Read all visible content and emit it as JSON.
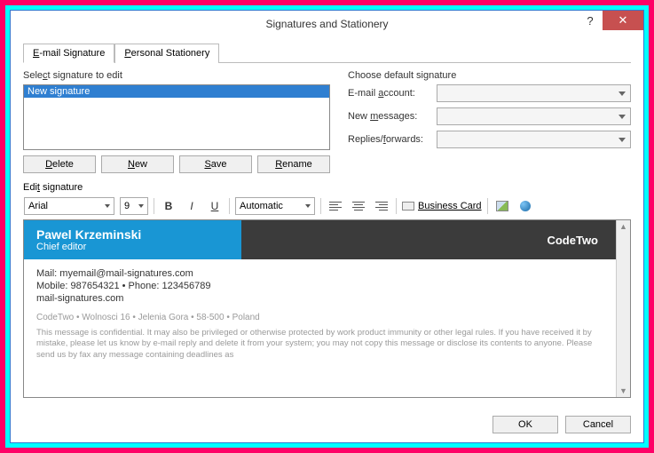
{
  "title": "Signatures and Stationery",
  "tabs": {
    "email": "E-mail Signature",
    "personal": "Personal Stationery"
  },
  "left": {
    "label": "Select signature to edit",
    "item": "New signature",
    "buttons": {
      "delete": "Delete",
      "new": "New",
      "save": "Save",
      "rename": "Rename"
    }
  },
  "right": {
    "label": "Choose default signature",
    "account": "E-mail account:",
    "newmsg": "New messages:",
    "replies": "Replies/forwards:"
  },
  "edit": {
    "label": "Edit signature",
    "font": "Arial",
    "size": "9",
    "auto": "Automatic",
    "biz": "Business Card"
  },
  "sig": {
    "name": "Pawel Krzeminski",
    "role": "Chief editor",
    "brand": "CodeTwo",
    "mail": "Mail: myemail@mail-signatures.com",
    "phone": "Mobile: 987654321 • Phone: 123456789",
    "site": "mail-signatures.com",
    "addr": "CodeTwo • Wolnosci 16 • Jelenia Gora • 58-500 • Poland",
    "disc": "This message is confidential. It may also be privileged or otherwise protected by work product immunity or other legal rules. If you have received it by mistake, please let us know by e-mail reply and delete it from your system; you may not copy this message or disclose its contents to anyone. Please send us by fax any message containing deadlines as"
  },
  "footer": {
    "ok": "OK",
    "cancel": "Cancel"
  }
}
